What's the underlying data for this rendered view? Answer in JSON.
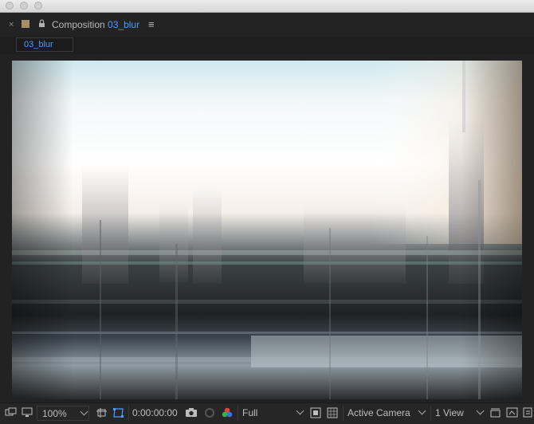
{
  "window": {
    "traffic_lights": [
      "close",
      "minimize",
      "zoom"
    ]
  },
  "panel": {
    "close_glyph": "×",
    "composition_prefix": "Composition",
    "composition_name": "03_blur",
    "menu_glyph": "≡"
  },
  "tab": {
    "label": "03_blur"
  },
  "toolbar": {
    "magnification": "100%",
    "timecode": "0:00:00:00",
    "resolution": "Full",
    "view": "Active Camera",
    "layout": "1 View",
    "accent": "#4d9bff"
  },
  "icons": [
    "always-preview-icon",
    "monitor-icon",
    "choose-grid-icon",
    "mask-visibility-icon",
    "snapshot-icon",
    "show-snapshot-icon",
    "color-channels-icon",
    "fast-previews-icon",
    "transparency-grid-icon",
    "reset-exposure-icon",
    "3d-draft-icon",
    "flowchart-icon"
  ]
}
